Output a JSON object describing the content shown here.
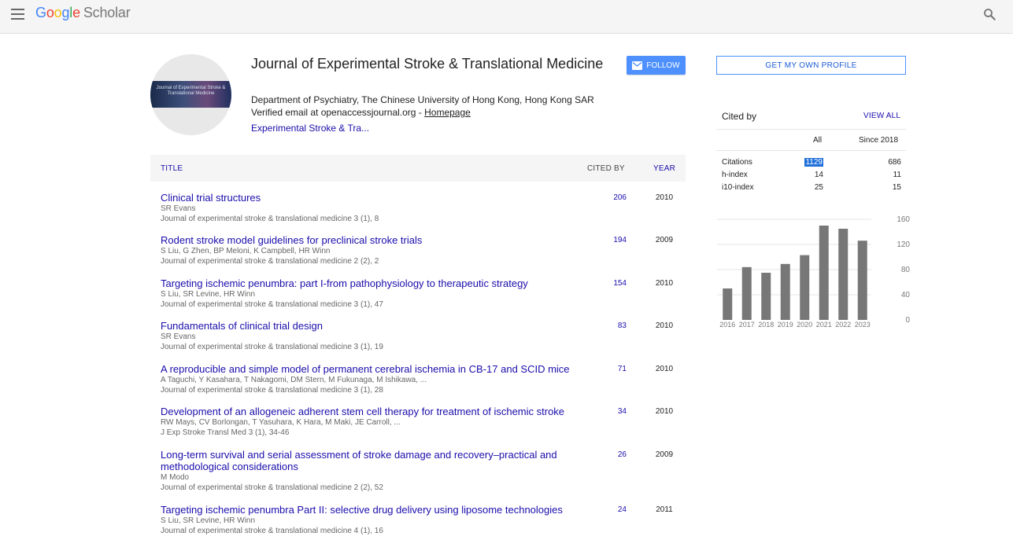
{
  "header": {
    "logo_letters": [
      "G",
      "o",
      "o",
      "g",
      "l",
      "e"
    ],
    "logo_suffix": "Scholar"
  },
  "profile": {
    "avatar_text": "Journal of Experimental Stroke & Translational Medicine",
    "name": "Journal of Experimental Stroke & Translational Medicine",
    "affiliation": "Department of Psychiatry, The Chinese University of Hong Kong, Hong Kong SAR",
    "email_text": "Verified email at openaccessjournal.org - ",
    "homepage_label": "Homepage",
    "interest": "Experimental Stroke & Tra...",
    "follow_label": "FOLLOW"
  },
  "sidebar": {
    "get_profile_label": "GET MY OWN PROFILE",
    "cited_by_title": "Cited by",
    "view_all_label": "VIEW ALL",
    "col_all": "All",
    "col_since": "Since 2018",
    "stats": [
      {
        "label": "Citations",
        "all": "1129",
        "since": "686"
      },
      {
        "label": "h-index",
        "all": "14",
        "since": "11"
      },
      {
        "label": "i10-index",
        "all": "25",
        "since": "15"
      }
    ]
  },
  "table": {
    "col_title": "TITLE",
    "col_cited": "CITED BY",
    "col_year": "YEAR",
    "rows": [
      {
        "title": "Clinical trial structures",
        "authors": "SR Evans",
        "venue": "Journal of experimental stroke & translational medicine 3 (1), 8",
        "cites": "206",
        "year": "2010"
      },
      {
        "title": "Rodent stroke model guidelines for preclinical stroke trials",
        "authors": "S Liu, G Zhen, BP Meloni, K Campbell, HR Winn",
        "venue": "Journal of experimental stroke & translational medicine 2 (2), 2",
        "cites": "194",
        "year": "2009"
      },
      {
        "title": "Targeting ischemic penumbra: part I-from pathophysiology to therapeutic strategy",
        "authors": "S Liu, SR Levine, HR Winn",
        "venue": "Journal of experimental stroke & translational medicine 3 (1), 47",
        "cites": "154",
        "year": "2010"
      },
      {
        "title": "Fundamentals of clinical trial design",
        "authors": "SR Evans",
        "venue": "Journal of experimental stroke & translational medicine 3 (1), 19",
        "cites": "83",
        "year": "2010"
      },
      {
        "title": "A reproducible and simple model of permanent cerebral ischemia in CB-17 and SCID mice",
        "authors": "A Taguchi, Y Kasahara, T Nakagomi, DM Stern, M Fukunaga, M Ishikawa, ...",
        "venue": "Journal of experimental stroke & translational medicine 3 (1), 28",
        "cites": "71",
        "year": "2010"
      },
      {
        "title": "Development of an allogeneic adherent stem cell therapy for treatment of ischemic stroke",
        "authors": "RW Mays, CV Borlongan, T Yasuhara, K Hara, M Maki, JE Carroll, ...",
        "venue": "J Exp Stroke Transl Med 3 (1), 34-46",
        "cites": "34",
        "year": "2010"
      },
      {
        "title": "Long-term survival and serial assessment of stroke damage and recovery–practical and methodological considerations",
        "authors": "M Modo",
        "venue": "Journal of experimental stroke & translational medicine 2 (2), 52",
        "cites": "26",
        "year": "2009"
      },
      {
        "title": "Targeting ischemic penumbra Part II: selective drug delivery using liposome technologies",
        "authors": "S Liu, SR Levine, HR Winn",
        "venue": "Journal of experimental stroke & translational medicine 4 (1), 16",
        "cites": "24",
        "year": "2011"
      }
    ]
  },
  "chart_data": {
    "type": "bar",
    "categories": [
      "2016",
      "2017",
      "2018",
      "2019",
      "2020",
      "2021",
      "2022",
      "2023"
    ],
    "values": [
      50,
      84,
      75,
      89,
      103,
      150,
      145,
      126
    ],
    "ylim": [
      0,
      160
    ],
    "yticks": [
      "0",
      "40",
      "80",
      "120",
      "160"
    ],
    "bar_color": "#777777",
    "grid": true
  }
}
